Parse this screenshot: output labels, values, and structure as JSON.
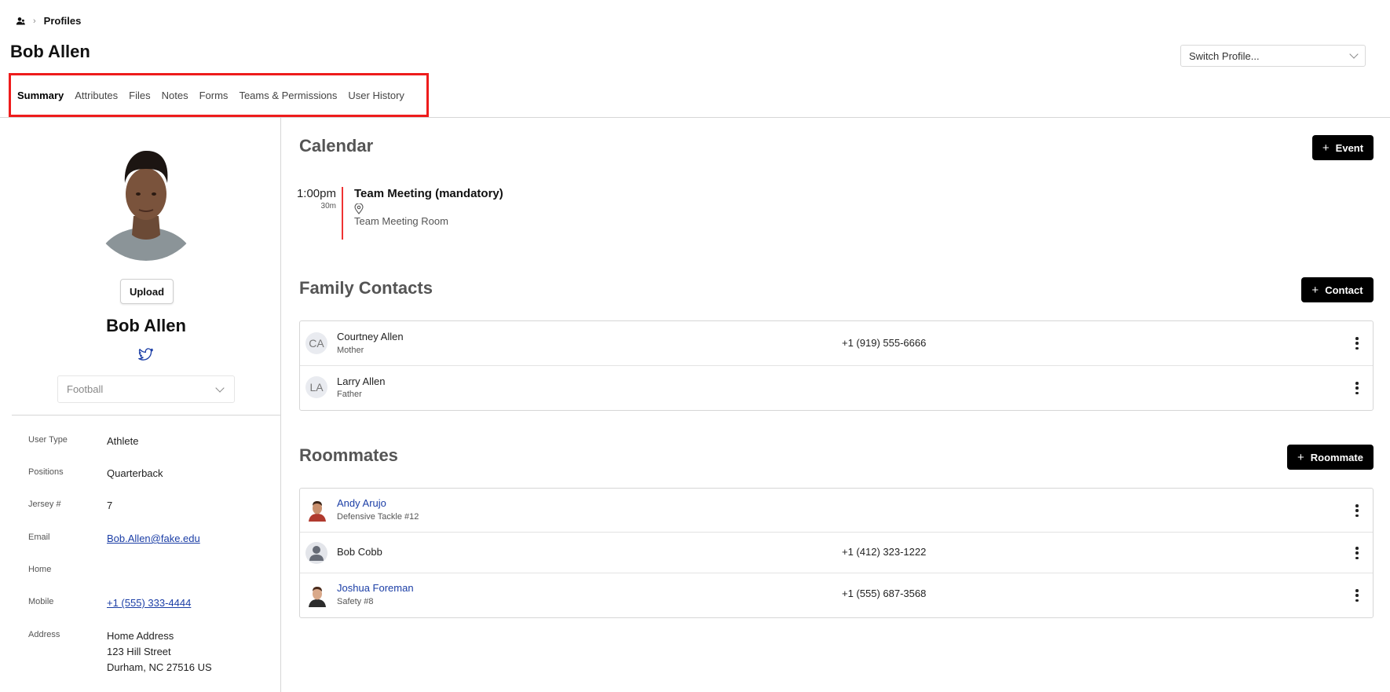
{
  "breadcrumb": {
    "icon": "people-icon",
    "label": "Profiles"
  },
  "page_title": "Bob Allen",
  "switch_profile": {
    "placeholder": "Switch Profile..."
  },
  "tabs": [
    {
      "label": "Summary",
      "active": true
    },
    {
      "label": "Attributes"
    },
    {
      "label": "Files"
    },
    {
      "label": "Notes"
    },
    {
      "label": "Forms"
    },
    {
      "label": "Teams & Permissions"
    },
    {
      "label": "User History"
    }
  ],
  "profile": {
    "upload_label": "Upload",
    "name": "Bob Allen",
    "social_icon": "twitter-icon",
    "sport": "Football",
    "fields": [
      {
        "label": "User Type",
        "value": "Athlete"
      },
      {
        "label": "Positions",
        "value": "Quarterback"
      },
      {
        "label": "Jersey #",
        "value": "7"
      },
      {
        "label": "Email",
        "value": "Bob.Allen@fake.edu"
      },
      {
        "label": "Home",
        "value": ""
      },
      {
        "label": "Mobile",
        "value": "+1 (555) 333-4444"
      },
      {
        "label": "Address",
        "value_lines": [
          "Home Address",
          "123 Hill Street",
          "Durham, NC 27516 US"
        ]
      }
    ]
  },
  "calendar": {
    "title": "Calendar",
    "button": "Event",
    "event": {
      "time": "1:00pm",
      "duration": "30m",
      "title": "Team Meeting (mandatory)",
      "location": "Team Meeting Room"
    }
  },
  "family": {
    "title": "Family Contacts",
    "button": "Contact",
    "rows": [
      {
        "initials": "CA",
        "name": "Courtney Allen",
        "relation": "Mother",
        "phone": "+1 (919) 555-6666"
      },
      {
        "initials": "LA",
        "name": "Larry Allen",
        "relation": "Father",
        "phone": ""
      }
    ]
  },
  "roommates": {
    "title": "Roommates",
    "button": "Roommate",
    "rows": [
      {
        "name": "Andy Arujo",
        "detail": "Defensive Tackle #12",
        "phone": ""
      },
      {
        "name": "Bob Cobb",
        "detail": "",
        "phone": "+1 (412) 323-1222"
      },
      {
        "name": "Joshua Foreman",
        "detail": "Safety #8",
        "phone": "+1 (555) 687-3568"
      }
    ]
  },
  "colors": {
    "accent_link": "#1b3ea6",
    "highlight": "#ee1c1c",
    "event_bar": "#e33333",
    "button_bg": "#000000"
  }
}
